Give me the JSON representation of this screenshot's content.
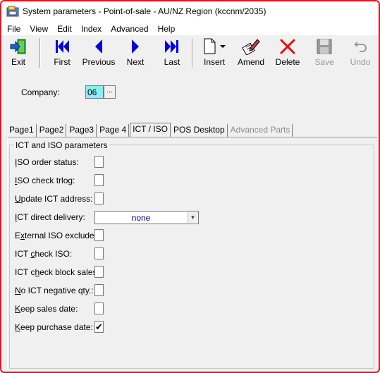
{
  "window": {
    "title": "System parameters - Point-of-sale - AU/NZ Region (kccnm/2035)"
  },
  "menu": {
    "file": "File",
    "view": "View",
    "edit": "Edit",
    "index": "Index",
    "advanced": "Advanced",
    "help": "Help"
  },
  "toolbar": {
    "exit": "Exit",
    "first": "First",
    "previous": "Previous",
    "next": "Next",
    "last": "Last",
    "insert": "Insert",
    "amend": "Amend",
    "delete": "Delete",
    "save": "Save",
    "undo": "Undo"
  },
  "company": {
    "label": "Company:",
    "value": "06",
    "lookup": "..."
  },
  "tabs": [
    "Page1",
    "Page2",
    "Page3",
    "Page 4",
    "ICT / ISO",
    "POS Desktop",
    "Advanced Parts"
  ],
  "group": {
    "title": "ICT and ISO parameters"
  },
  "fields": {
    "iso_order_status": {
      "u": "I",
      "rest": "SO order status:"
    },
    "iso_check_trlog": {
      "u": "I",
      "rest": "SO check trlog:"
    },
    "update_ict_address": {
      "u": "U",
      "rest": "pdate ICT address:"
    },
    "ict_direct_delivery": {
      "u": "I",
      "rest": "CT direct delivery:",
      "value": "none"
    },
    "external_iso_exclude": {
      "pre": "E",
      "u": "x",
      "rest": "ternal ISO exclude:"
    },
    "ict_check_iso": {
      "pre": "ICT ",
      "u": "c",
      "rest": "heck ISO:"
    },
    "ict_check_block_sales": {
      "pre": "ICT c",
      "u": "h",
      "rest": "eck block sales:"
    },
    "no_ict_negative_qty": {
      "u": "N",
      "rest": "o ICT negative qty.:"
    },
    "keep_sales_date": {
      "u": "K",
      "rest": "eep sales date:"
    },
    "keep_purchase_date": {
      "u": "K",
      "rest": "eep purchase date:",
      "checked": "✔"
    }
  },
  "colors": {
    "window_border": "#e81123",
    "company_field": "#87f0f5",
    "dropdown_text": "#00008b",
    "nav_blue": "#0000e6"
  }
}
